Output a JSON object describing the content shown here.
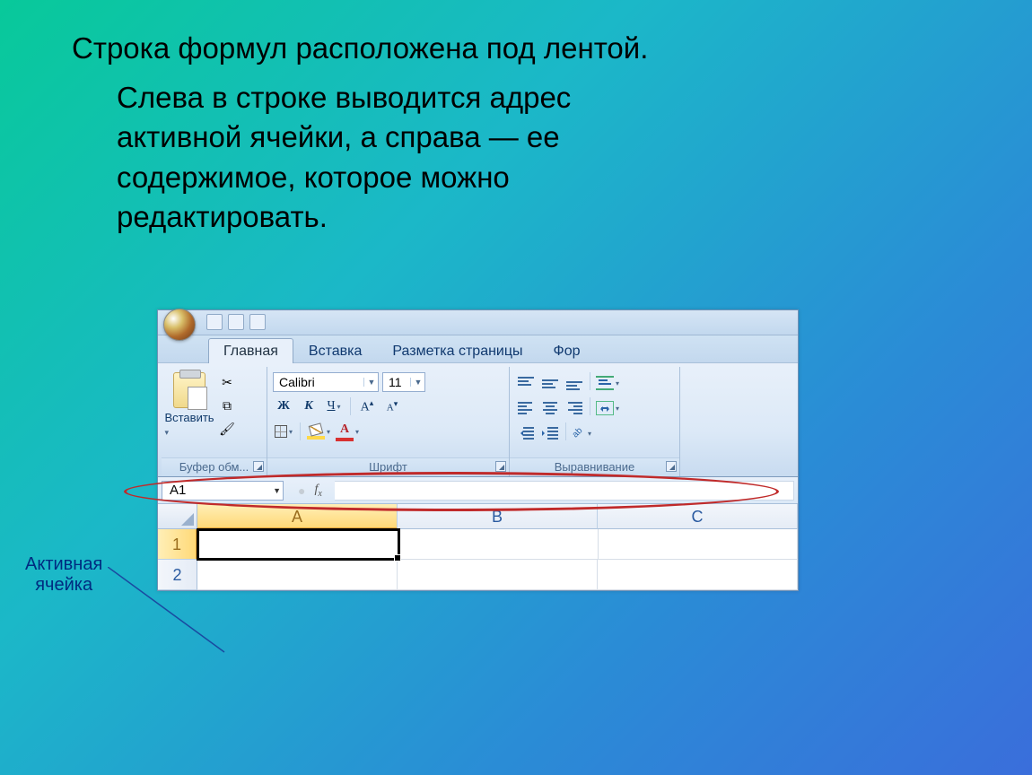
{
  "slide": {
    "line1": "Строка формул расположена под лентой.",
    "line2": "Слева в строке выводится адрес",
    "line3": "активной ячейки, а справа — ее",
    "line4": "содержимое, которое можно",
    "line5": "редактировать."
  },
  "callout": {
    "line1": "Активная",
    "line2": "ячейка"
  },
  "ribbon": {
    "tabs": {
      "home": "Главная",
      "insert": "Вставка",
      "layout": "Разметка страницы",
      "formulas": "Фор"
    },
    "clipboard": {
      "paste": "Вставить",
      "group": "Буфер обм..."
    },
    "font": {
      "name": "Calibri",
      "size": "11",
      "bold": "Ж",
      "italic": "К",
      "underline": "Ч",
      "bigA": "A",
      "group": "Шрифт"
    },
    "align": {
      "group": "Выравнивание"
    }
  },
  "formula_bar": {
    "name_box": "A1",
    "fx": "fx"
  },
  "grid": {
    "columns": [
      "A",
      "B",
      "C"
    ],
    "rows": [
      "1",
      "2"
    ]
  }
}
